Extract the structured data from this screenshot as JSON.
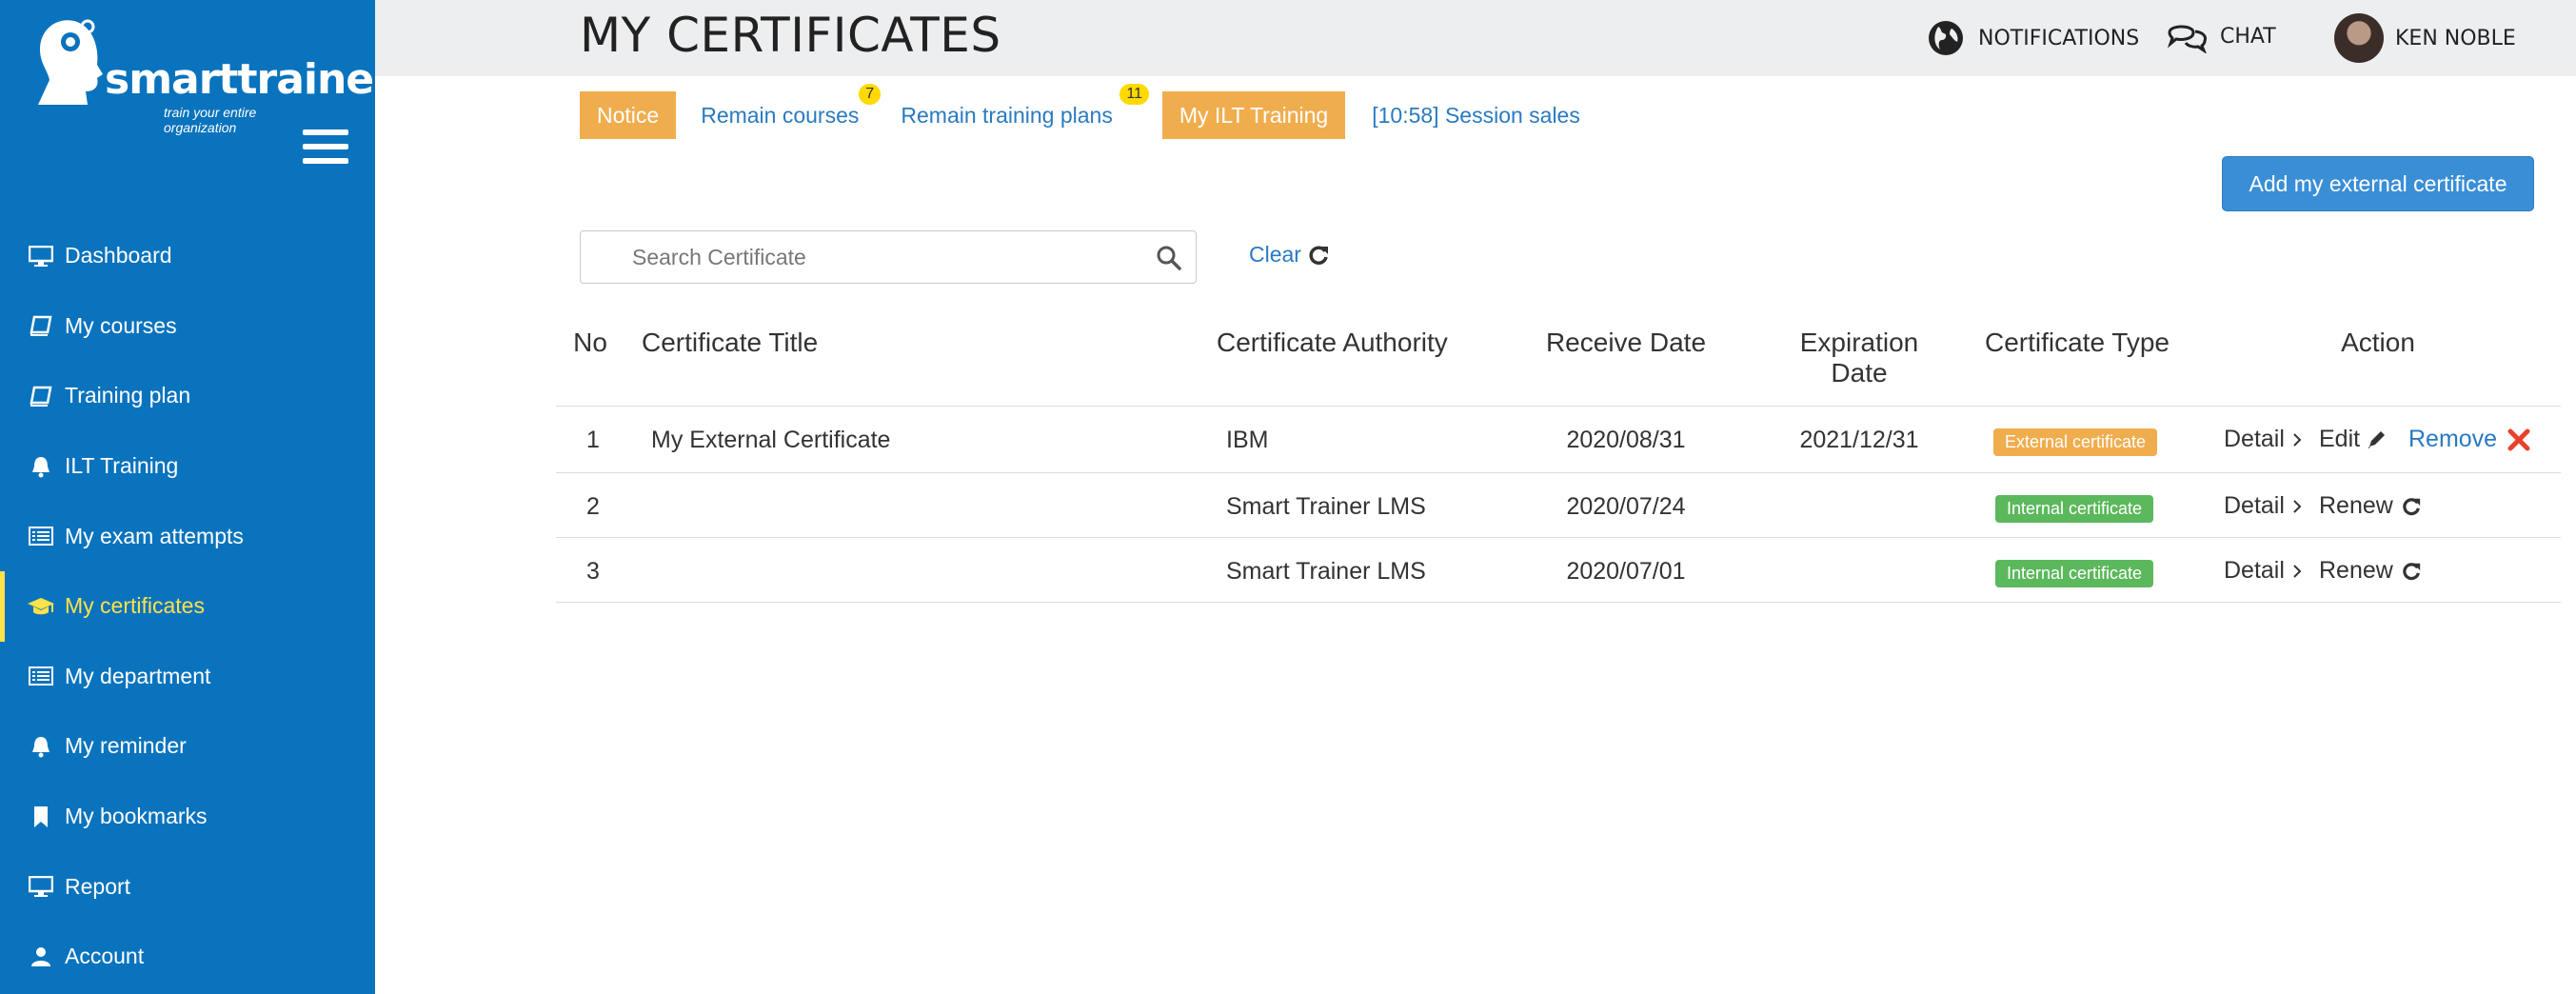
{
  "brand": {
    "name": "smarttrainer",
    "tagline": "train your entire organization"
  },
  "sidebar": {
    "items": [
      {
        "label": "Dashboard",
        "icon": "monitor-icon"
      },
      {
        "label": "My courses",
        "icon": "book-icon"
      },
      {
        "label": "Training plan",
        "icon": "book-icon"
      },
      {
        "label": "ILT Training",
        "icon": "bell-icon"
      },
      {
        "label": "My exam attempts",
        "icon": "list-icon"
      },
      {
        "label": "My certificates",
        "icon": "graduation-cap-icon",
        "active": true
      },
      {
        "label": "My department",
        "icon": "list-icon"
      },
      {
        "label": "My reminder",
        "icon": "bell-icon"
      },
      {
        "label": "My bookmarks",
        "icon": "bookmark-icon"
      },
      {
        "label": "Report",
        "icon": "monitor-icon"
      },
      {
        "label": "Account",
        "icon": "user-icon"
      }
    ]
  },
  "header": {
    "title": "MY CERTIFICATES",
    "notifications": "NOTIFICATIONS",
    "chat": "CHAT",
    "user": "KEN NOBLE"
  },
  "subnav": {
    "notice": "Notice",
    "remain_courses": "Remain courses",
    "remain_courses_count": "7",
    "remain_plans": "Remain training plans",
    "remain_plans_count": "11",
    "ilt": "My ILT Training",
    "session": "[10:58] Session sales"
  },
  "toolbar": {
    "add_label": "Add my external certificate",
    "search_placeholder": "Search Certificate",
    "clear_label": "Clear"
  },
  "table": {
    "headers": {
      "no": "No",
      "title": "Certificate Title",
      "authority": "Certificate Authority",
      "receive": "Receive Date",
      "expiration_1": "Expiration",
      "expiration_2": "Date",
      "type": "Certificate Type",
      "action": "Action"
    },
    "rows": [
      {
        "no": "1",
        "title": "My External Certificate",
        "authority": "IBM",
        "receive": "2020/08/31",
        "expiration": "2021/12/31",
        "type": "External certificate",
        "detail": "Detail",
        "edit": "Edit",
        "remove": "Remove"
      },
      {
        "no": "2",
        "title": "",
        "authority": "Smart Trainer LMS",
        "receive": "2020/07/24",
        "expiration": "",
        "type": "Internal certificate",
        "detail": "Detail",
        "renew": "Renew"
      },
      {
        "no": "3",
        "title": "",
        "authority": "Smart Trainer LMS",
        "receive": "2020/07/01",
        "expiration": "",
        "type": "Internal certificate",
        "detail": "Detail",
        "renew": "Renew"
      }
    ]
  },
  "colors": {
    "sidebar": "#0a73bd",
    "active": "#ffe14a",
    "accent_orange": "#f0ad4e",
    "link_blue": "#2a7ac0",
    "success_green": "#5cb85c",
    "remove_red": "#e8412b"
  }
}
